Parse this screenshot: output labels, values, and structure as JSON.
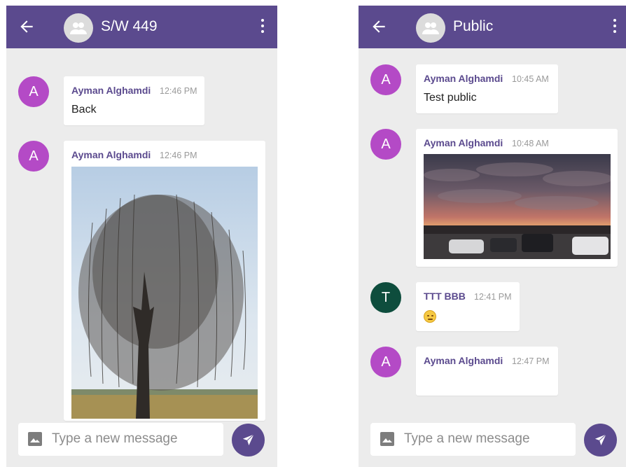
{
  "colors": {
    "primary": "#5b4a8e",
    "background": "#ececec",
    "avatar_purple": "#b44ac6",
    "avatar_green": "#0e4d3d"
  },
  "left": {
    "title": "S/W 449",
    "messages": [
      {
        "avatar_letter": "A",
        "sender": "Ayman Alghamdi",
        "time": "12:46 PM",
        "text": "Back"
      },
      {
        "avatar_letter": "A",
        "sender": "Ayman Alghamdi",
        "time": "12:46 PM",
        "image": "tree-photo"
      }
    ],
    "input_placeholder": "Type a new message"
  },
  "right": {
    "title": "Public",
    "messages": [
      {
        "avatar_letter": "A",
        "sender": "Ayman Alghamdi",
        "time": "10:45 AM",
        "text": "Test public"
      },
      {
        "avatar_letter": "A",
        "sender": "Ayman Alghamdi",
        "time": "10:48 AM",
        "image": "sunset-parking-photo"
      },
      {
        "avatar_letter": "T",
        "sender": "TTT BBB",
        "time": "12:41 PM",
        "emoji": "smiley"
      },
      {
        "avatar_letter": "A",
        "sender": "Ayman Alghamdi",
        "time": "12:47 PM",
        "text": ""
      }
    ],
    "input_placeholder": "Type a new message"
  },
  "icons": [
    "back-arrow-icon",
    "group-icon",
    "more-vert-icon",
    "image-icon",
    "send-icon"
  ]
}
